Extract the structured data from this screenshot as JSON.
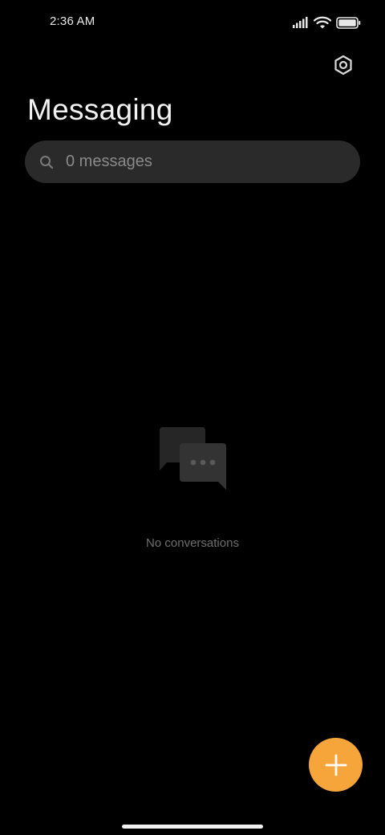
{
  "status_bar": {
    "time": "2:36 AM",
    "icons": [
      "signal-icon",
      "wifi-icon",
      "battery-icon"
    ]
  },
  "header": {
    "title": "Messaging",
    "settings_icon": "settings-hex-icon"
  },
  "search": {
    "placeholder": "0 messages",
    "icon": "search-icon"
  },
  "empty_state": {
    "icon": "chat-bubbles-icon",
    "text": "No conversations"
  },
  "fab": {
    "icon": "plus-icon",
    "color": "#f6a53a"
  },
  "colors": {
    "background": "#000000",
    "accent": "#f6a53a",
    "search_bg": "#2a2a2a"
  }
}
